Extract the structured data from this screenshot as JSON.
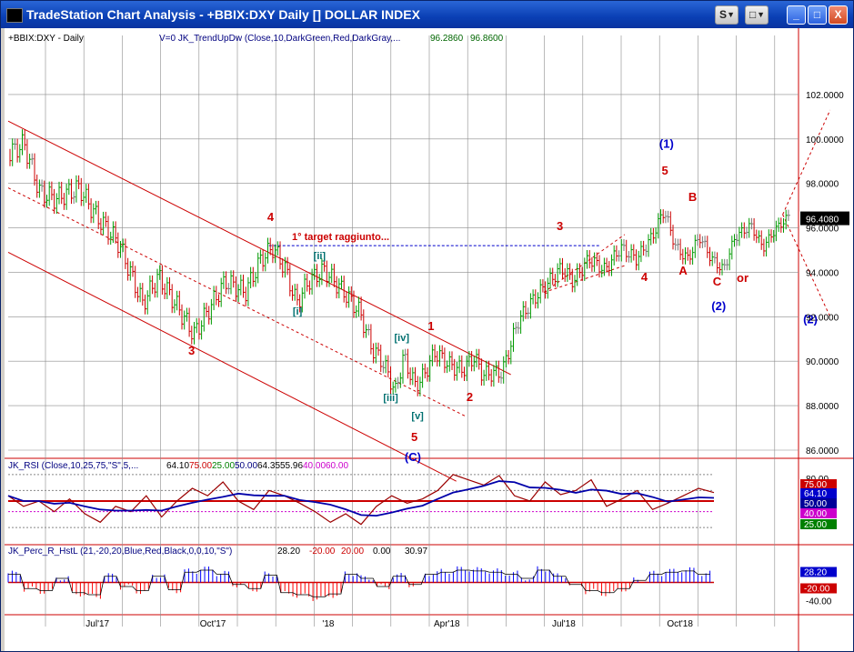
{
  "window": {
    "title": "TradeStation Chart Analysis - +BBIX:DXY Daily [] DOLLAR INDEX",
    "controls": [
      "S",
      "□",
      "_",
      "□",
      "X"
    ]
  },
  "colors": {
    "background": "#ffffff",
    "grid": "#8c8c8c",
    "channel": "#cc0000",
    "target_line": "#0000cc",
    "wave_red": "#cc0000",
    "wave_blue": "#0000cc",
    "wave_teal": "#007070",
    "price_up": "#009900",
    "price_down": "#cc0000",
    "price_neutral": "#777777",
    "rsi_line": "#9b0000",
    "rsi_avg": "#0000aa",
    "perc_up": "#0000ff",
    "perc_down": "#ff0000"
  },
  "price_panel": {
    "symbol_label": "+BBIX:DXY - Daily",
    "indicator_label": "V=0  JK_TrendUpDw (Close,10,DarkGreen,Red,DarkGray,...",
    "indicator_v1": "96.2860",
    "indicator_v2": "96.8600",
    "last_price": "96.4080",
    "target_text": "1° target raggiunto...",
    "or_text": "or",
    "wave_labels": [
      {
        "text": "3",
        "color": "red",
        "time": 0.232,
        "price": 90.3
      },
      {
        "text": "4",
        "color": "red",
        "time": 0.332,
        "price": 96.3
      },
      {
        "text": "[ii]",
        "color": "teal",
        "time": 0.394,
        "price": 94.6
      },
      {
        "text": "[i]",
        "color": "teal",
        "time": 0.366,
        "price": 92.1
      },
      {
        "text": "[iv]",
        "color": "teal",
        "time": 0.498,
        "price": 90.9
      },
      {
        "text": "1",
        "color": "red",
        "time": 0.535,
        "price": 91.4
      },
      {
        "text": "[iii]",
        "color": "teal",
        "time": 0.484,
        "price": 88.2
      },
      {
        "text": "[v]",
        "color": "teal",
        "time": 0.518,
        "price": 87.4
      },
      {
        "text": "2",
        "color": "red",
        "time": 0.584,
        "price": 88.2
      },
      {
        "text": "5",
        "color": "red",
        "time": 0.514,
        "price": 86.4
      },
      {
        "text": "(C)",
        "color": "blue",
        "time": 0.512,
        "price": 85.5
      },
      {
        "text": "3",
        "color": "red",
        "time": 0.698,
        "price": 95.9
      },
      {
        "text": "4",
        "color": "red",
        "time": 0.805,
        "price": 93.6
      },
      {
        "text": "(1)",
        "color": "blue",
        "time": 0.833,
        "price": 99.6
      },
      {
        "text": "5",
        "color": "red",
        "time": 0.831,
        "price": 98.4
      },
      {
        "text": "B",
        "color": "red",
        "time": 0.866,
        "price": 97.2
      },
      {
        "text": "A",
        "color": "red",
        "time": 0.854,
        "price": 93.9
      },
      {
        "text": "C",
        "color": "red",
        "time": 0.897,
        "price": 93.4
      },
      {
        "text": "(2)",
        "color": "blue",
        "time": 0.899,
        "price": 92.3
      },
      {
        "text": "(2)",
        "color": "blue",
        "time": 1.015,
        "price": 91.7
      }
    ]
  },
  "rsi_panel": {
    "label": "JK_RSI (Close,10,25,75,\"S\",5,...",
    "values": [
      {
        "text": "64.10",
        "color": "#000000"
      },
      {
        "text": "75.00",
        "color": "#cc0000"
      },
      {
        "text": "25.00",
        "color": "#008000"
      },
      {
        "text": "50.00",
        "color": "#000080"
      },
      {
        "text": "64.35",
        "color": "#000000"
      },
      {
        "text": "55.96",
        "color": "#000000"
      },
      {
        "text": "40.00",
        "color": "#cc00cc"
      },
      {
        "text": "60.00",
        "color": "#cc00cc"
      }
    ],
    "axis_tags": [
      {
        "text": "75.00",
        "bg": "#cc0000",
        "fg": "#ffffff"
      },
      {
        "text": "64.10",
        "bg": "#0000cc",
        "fg": "#ffffff"
      },
      {
        "text": "50.00",
        "bg": "#000099",
        "fg": "#ffffff"
      },
      {
        "text": "40.00",
        "bg": "#cc00cc",
        "fg": "#ffffff"
      },
      {
        "text": "25.00",
        "bg": "#008000",
        "fg": "#ffffff"
      }
    ],
    "top_tick": "80.00"
  },
  "perc_panel": {
    "label": "JK_Perc_R_HstL (21,-20,20,Blue,Red,Black,0,0,10,\"S\")",
    "values": [
      {
        "text": "28.20",
        "color": "#000000"
      },
      {
        "text": "-20.00",
        "color": "#cc0000"
      },
      {
        "text": "20.00",
        "color": "#cc0000"
      },
      {
        "text": "0.00",
        "color": "#000000"
      },
      {
        "text": "30.97",
        "color": "#000000"
      }
    ],
    "axis_tags": [
      {
        "text": "28.20",
        "bg": "#0000cc",
        "fg": "#ffffff"
      },
      {
        "text": "-20.00",
        "bg": "#cc0000",
        "fg": "#ffffff"
      }
    ],
    "lower_tick": "-40.00"
  },
  "chart_data": {
    "type": "line",
    "title": "",
    "xlabel": "",
    "ylabel": "",
    "ylim": [
      84.0,
      103.0
    ],
    "y_ticks": [
      "102.0000",
      "100.0000",
      "98.0000",
      "96.0000",
      "94.0000",
      "92.0000",
      "90.0000",
      "88.0000",
      "86.0000"
    ],
    "x_ticks": [
      "Jul'17",
      "Oct'17",
      "'18",
      "Apr'18",
      "Jul'18",
      "Oct'18"
    ],
    "x_tick_positions": [
      0.113,
      0.259,
      0.405,
      0.555,
      0.703,
      0.85
    ],
    "price_path": [
      {
        "t": 0.0,
        "p": 99.3
      },
      {
        "t": 0.02,
        "p": 99.8
      },
      {
        "t": 0.04,
        "p": 97.6
      },
      {
        "t": 0.06,
        "p": 97.3
      },
      {
        "t": 0.09,
        "p": 97.8
      },
      {
        "t": 0.11,
        "p": 96.6
      },
      {
        "t": 0.14,
        "p": 95.3
      },
      {
        "t": 0.17,
        "p": 92.6
      },
      {
        "t": 0.19,
        "p": 93.8
      },
      {
        "t": 0.215,
        "p": 92.4
      },
      {
        "t": 0.235,
        "p": 91.2
      },
      {
        "t": 0.255,
        "p": 92.4
      },
      {
        "t": 0.275,
        "p": 93.6
      },
      {
        "t": 0.3,
        "p": 93.1
      },
      {
        "t": 0.32,
        "p": 94.6
      },
      {
        "t": 0.335,
        "p": 95.1
      },
      {
        "t": 0.35,
        "p": 94.2
      },
      {
        "t": 0.365,
        "p": 92.6
      },
      {
        "t": 0.38,
        "p": 93.6
      },
      {
        "t": 0.4,
        "p": 94.1
      },
      {
        "t": 0.425,
        "p": 93.1
      },
      {
        "t": 0.445,
        "p": 92.2
      },
      {
        "t": 0.46,
        "p": 90.6
      },
      {
        "t": 0.475,
        "p": 89.9
      },
      {
        "t": 0.49,
        "p": 88.6
      },
      {
        "t": 0.5,
        "p": 90.2
      },
      {
        "t": 0.515,
        "p": 88.9
      },
      {
        "t": 0.525,
        "p": 89.3
      },
      {
        "t": 0.54,
        "p": 90.4
      },
      {
        "t": 0.56,
        "p": 89.8
      },
      {
        "t": 0.575,
        "p": 89.6
      },
      {
        "t": 0.59,
        "p": 90.2
      },
      {
        "t": 0.6,
        "p": 89.4
      },
      {
        "t": 0.625,
        "p": 89.5
      },
      {
        "t": 0.645,
        "p": 91.8
      },
      {
        "t": 0.665,
        "p": 92.8
      },
      {
        "t": 0.685,
        "p": 93.6
      },
      {
        "t": 0.7,
        "p": 94.2
      },
      {
        "t": 0.715,
        "p": 93.6
      },
      {
        "t": 0.735,
        "p": 94.6
      },
      {
        "t": 0.755,
        "p": 94.1
      },
      {
        "t": 0.775,
        "p": 95.1
      },
      {
        "t": 0.795,
        "p": 94.6
      },
      {
        "t": 0.815,
        "p": 95.6
      },
      {
        "t": 0.83,
        "p": 96.8
      },
      {
        "t": 0.845,
        "p": 95.1
      },
      {
        "t": 0.86,
        "p": 94.6
      },
      {
        "t": 0.875,
        "p": 95.6
      },
      {
        "t": 0.89,
        "p": 94.6
      },
      {
        "t": 0.905,
        "p": 94.1
      },
      {
        "t": 0.92,
        "p": 95.6
      },
      {
        "t": 0.94,
        "p": 96.1
      },
      {
        "t": 0.955,
        "p": 95.1
      },
      {
        "t": 0.97,
        "p": 95.9
      },
      {
        "t": 0.99,
        "p": 96.6
      }
    ],
    "channel_lines": [
      {
        "from": {
          "t": 0.0,
          "p": 100.8
        },
        "to": {
          "t": 0.636,
          "p": 89.4
        },
        "style": "solid"
      },
      {
        "from": {
          "t": 0.0,
          "p": 94.9
        },
        "to": {
          "t": 0.567,
          "p": 84.6
        },
        "style": "solid"
      },
      {
        "from": {
          "t": 0.0,
          "p": 97.8
        },
        "to": {
          "t": 0.58,
          "p": 87.5
        },
        "style": "dashed"
      },
      {
        "from": {
          "t": 0.678,
          "p": 93.1
        },
        "to": {
          "t": 0.78,
          "p": 95.7
        },
        "style": "dashed"
      },
      {
        "from": {
          "t": 0.678,
          "p": 93.1
        },
        "to": {
          "t": 0.78,
          "p": 94.3
        },
        "style": "dashed"
      },
      {
        "from": {
          "t": 0.98,
          "p": 96.6
        },
        "to": {
          "t": 1.04,
          "p": 101.3
        },
        "style": "dashed"
      },
      {
        "from": {
          "t": 0.98,
          "p": 96.6
        },
        "to": {
          "t": 1.04,
          "p": 92.0
        },
        "style": "dashed"
      }
    ],
    "target_line": {
      "from_t": 0.33,
      "to_t": 0.75,
      "p": 95.2
    },
    "rsi_series": [
      {
        "name": "",
        "values": [
          55,
          45,
          50,
          40,
          52,
          38,
          30,
          45,
          40,
          55,
          35,
          50,
          62,
          55,
          68,
          50,
          42,
          60,
          55,
          48,
          40,
          30,
          38,
          28,
          45,
          55,
          48,
          52,
          60,
          75,
          70,
          65,
          74,
          55,
          50,
          68,
          56,
          60,
          70,
          45,
          52,
          60,
          42,
          48,
          55,
          62,
          58
        ]
      }
    ],
    "rsi_levels": [
      75,
      60,
      50,
      40,
      25
    ],
    "perc_series": [
      {
        "name": "",
        "values": [
          20,
          -15,
          -20,
          10,
          -25,
          -30,
          15,
          -10,
          -20,
          15,
          -18,
          25,
          30,
          20,
          -5,
          -15,
          18,
          -25,
          -30,
          -35,
          -28,
          20,
          10,
          -10,
          15,
          -5,
          20,
          25,
          30,
          28,
          25,
          20,
          10,
          30,
          15,
          -5,
          -20,
          -25,
          -15,
          5,
          20,
          25,
          28,
          20
        ]
      }
    ]
  }
}
